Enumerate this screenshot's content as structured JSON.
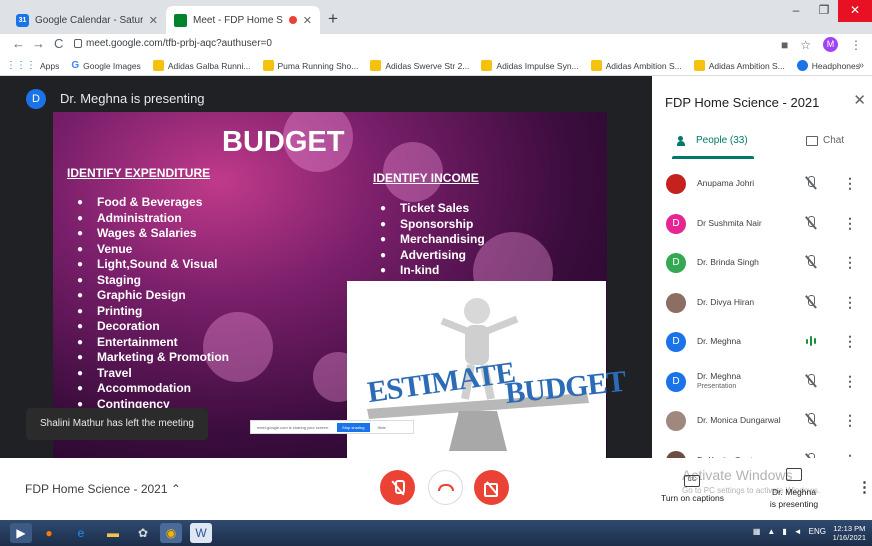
{
  "browser": {
    "tabs": [
      {
        "title": "Google Calendar - Saturday, Jan..."
      },
      {
        "title": "Meet - FDP Home Science -"
      }
    ],
    "new_tab": "+",
    "url": "meet.google.com/tfb-prbj-aqc?authuser=0",
    "profile_initial": "M",
    "bookmarks": [
      "Apps",
      "Google Images",
      "Adidas Galba Runni...",
      "Puma Running Sho...",
      "Adidas Swerve Str 2...",
      "Adidas Impulse Syn...",
      "Adidas Ambition S...",
      "Adidas Ambition S...",
      "Headphones"
    ],
    "bookmarks_more": "»"
  },
  "stage": {
    "presenter_initial": "D",
    "presenter_label": "Dr. Meghna is presenting",
    "toast": "Shalini Mathur has left the meeting",
    "sharebar_text": "meet.google.com is sharing your screen.",
    "sharebar_stop": "Stop sharing",
    "sharebar_hide": "Hide"
  },
  "slide": {
    "title": "BUDGET",
    "left_heading": "IDENTIFY EXPENDITURE",
    "left_items": [
      "Food & Beverages",
      "Administration",
      "Wages & Salaries",
      "Venue",
      "Light,Sound & Visual",
      "Staging",
      "Graphic Design",
      "Printing",
      "Decoration",
      "Entertainment",
      "Marketing & Promotion",
      "Travel",
      "Accommodation",
      "Contingency"
    ],
    "right_heading": "IDENTIFY INCOME",
    "right_items": [
      "Ticket Sales",
      "Sponsorship",
      "Merchandising",
      "Advertising",
      "In-kind"
    ],
    "illus_left": "ESTIMATE",
    "illus_right": "BUDGET"
  },
  "panel": {
    "title": "FDP Home Science - 2021",
    "tab_people": "People (33)",
    "tab_chat": "Chat",
    "participants": [
      {
        "initial": "",
        "name": "Anupama Johri",
        "sub": "",
        "color": "#c5221f",
        "photo": true,
        "mic": "off"
      },
      {
        "initial": "D",
        "name": "Dr Sushmita Nair",
        "sub": "",
        "color": "#e52592",
        "photo": false,
        "mic": "off"
      },
      {
        "initial": "D",
        "name": "Dr. Brinda Singh",
        "sub": "",
        "color": "#34a853",
        "photo": false,
        "mic": "off"
      },
      {
        "initial": "",
        "name": "Dr. Divya Hiran",
        "sub": "",
        "color": "#8d6e63",
        "photo": true,
        "mic": "off"
      },
      {
        "initial": "D",
        "name": "Dr. Meghna",
        "sub": "",
        "color": "#1a73e8",
        "photo": false,
        "mic": "on"
      },
      {
        "initial": "D",
        "name": "Dr. Meghna",
        "sub": "Presentation",
        "color": "#1a73e8",
        "photo": false,
        "mic": "off"
      },
      {
        "initial": "",
        "name": "Dr. Monica Dungarwal",
        "sub": "",
        "color": "#a1887f",
        "photo": true,
        "mic": "off"
      },
      {
        "initial": "",
        "name": "Dr Kavita Gautam",
        "sub": "",
        "color": "#6d4c41",
        "photo": true,
        "mic": "off"
      }
    ]
  },
  "bottom": {
    "meeting_name": "FDP Home Science - 2021",
    "activate_title": "Activate Windows",
    "activate_sub": "Go to PC settings to activate Windows.",
    "cc_label": "Turn on captions",
    "cc_icon_text": "CC",
    "present_label": "Dr. Meghna is presenting"
  },
  "taskbar": {
    "lang": "ENG",
    "time": "12:13 PM",
    "date": "1/16/2021"
  }
}
